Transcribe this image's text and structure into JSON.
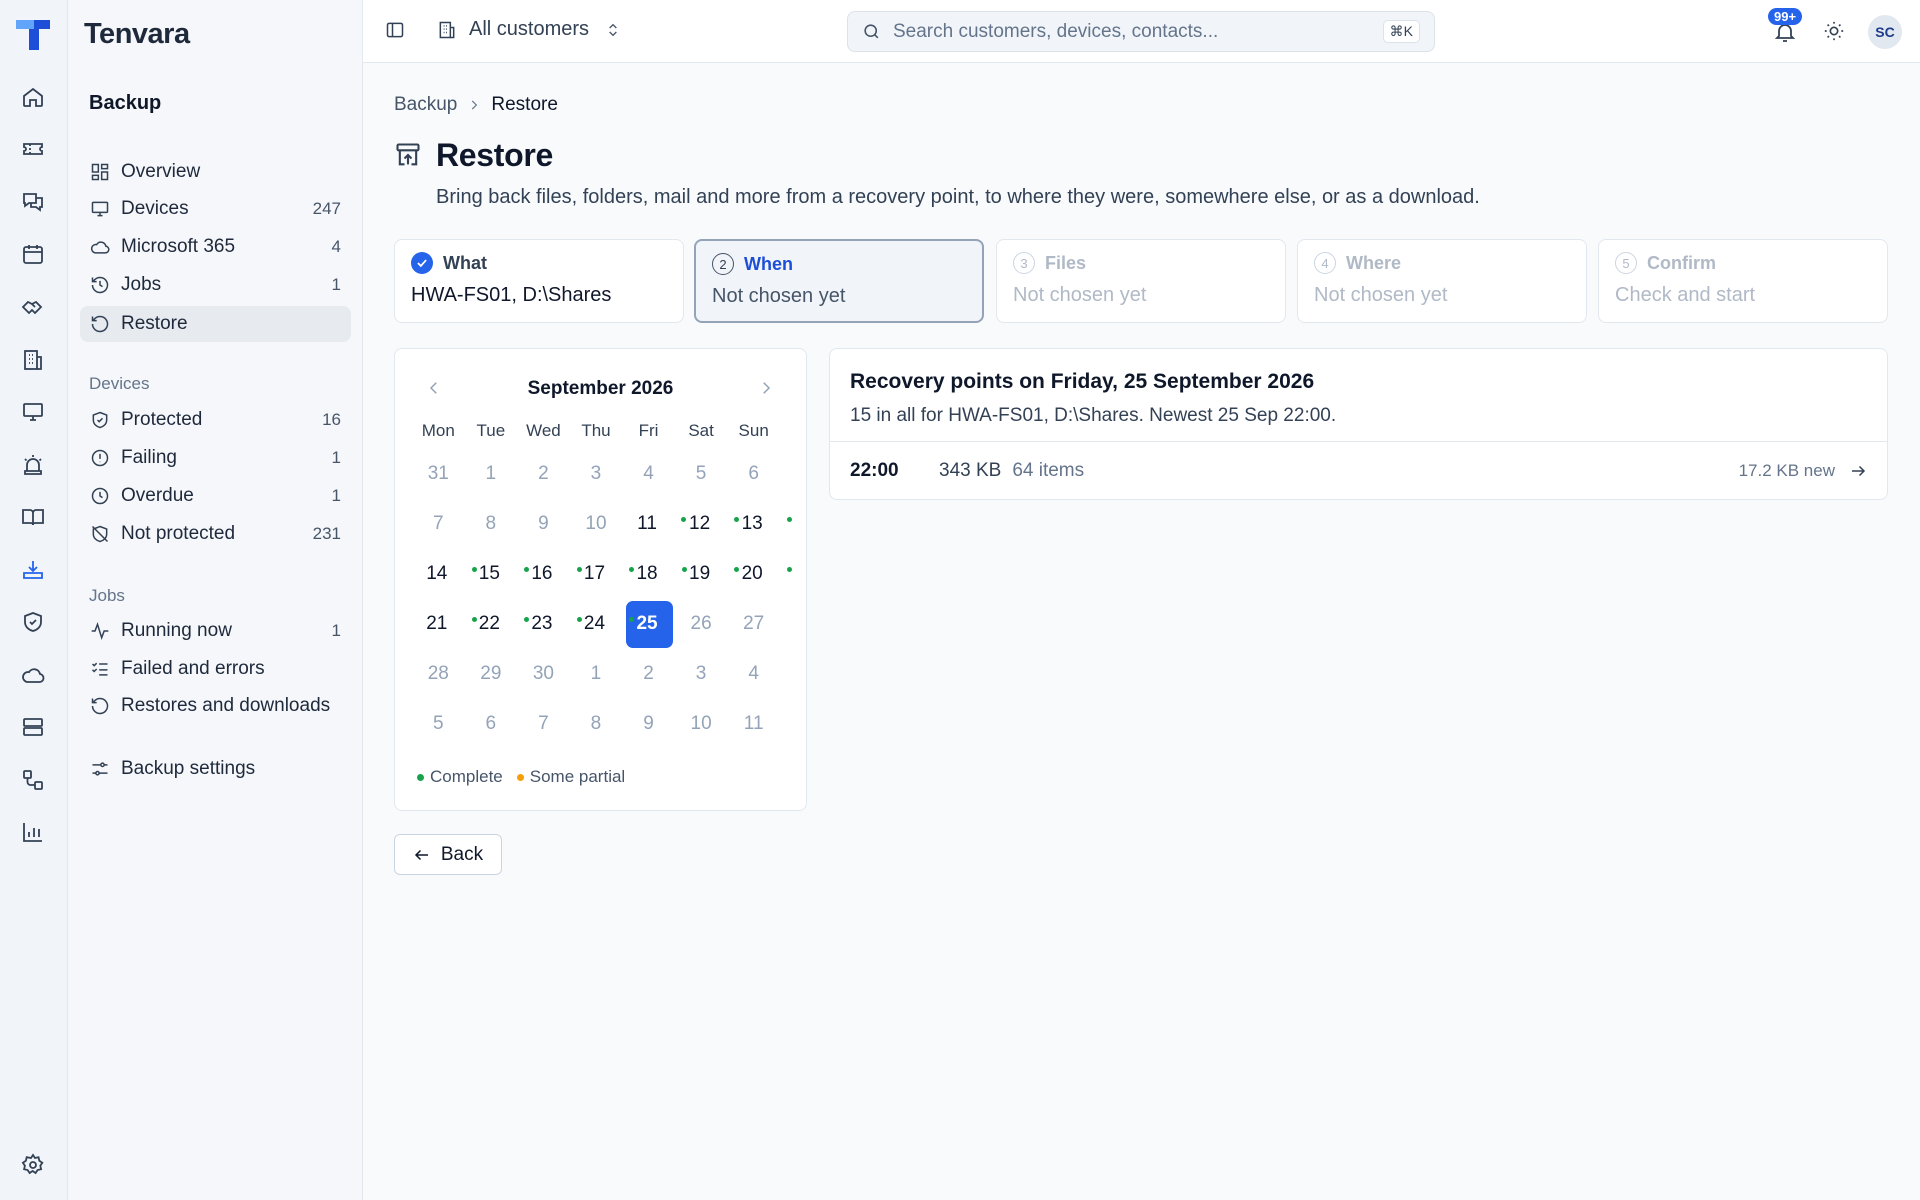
{
  "brand": {
    "name": "Tenvara"
  },
  "topbar": {
    "customer_selector": "All customers",
    "search_placeholder": "Search customers, devices, contacts...",
    "search_shortcut": "⌘K",
    "notifications_badge": "99+",
    "avatar_initials": "SC"
  },
  "sidebar": {
    "section_title": "Backup",
    "main_items": [
      {
        "label": "Overview",
        "count": "",
        "icon": "grid-icon"
      },
      {
        "label": "Devices",
        "count": "247",
        "icon": "monitor-icon"
      },
      {
        "label": "Microsoft 365",
        "count": "4",
        "icon": "cloud-icon"
      },
      {
        "label": "Jobs",
        "count": "1",
        "icon": "history-icon"
      },
      {
        "label": "Restore",
        "count": "",
        "icon": "restore-icon",
        "active": true
      }
    ],
    "devices_group": {
      "title": "Devices",
      "items": [
        {
          "label": "Protected",
          "count": "16",
          "icon": "shield-check-icon"
        },
        {
          "label": "Failing",
          "count": "1",
          "icon": "alert-circle-icon"
        },
        {
          "label": "Overdue",
          "count": "1",
          "icon": "clock-icon"
        },
        {
          "label": "Not protected",
          "count": "231",
          "icon": "shield-off-icon"
        }
      ]
    },
    "jobs_group": {
      "title": "Jobs",
      "items": [
        {
          "label": "Running now",
          "count": "1",
          "icon": "activity-icon"
        },
        {
          "label": "Failed and errors",
          "count": "",
          "icon": "list-checks-icon"
        },
        {
          "label": "Restores and downloads",
          "count": "",
          "icon": "restore-icon"
        }
      ]
    },
    "settings_item": {
      "label": "Backup settings",
      "icon": "sliders-icon"
    }
  },
  "breadcrumb": {
    "parent": "Backup",
    "current": "Restore"
  },
  "page": {
    "title": "Restore",
    "subtitle": "Bring back files, folders, mail and more from a recovery point, to where they were, somewhere else, or as a download."
  },
  "steps": [
    {
      "number": "1",
      "title": "What",
      "value": "HWA-FS01, D:\\Shares",
      "state": "done"
    },
    {
      "number": "2",
      "title": "When",
      "value": "Not chosen yet",
      "state": "current"
    },
    {
      "number": "3",
      "title": "Files",
      "value": "Not chosen yet",
      "state": "todo"
    },
    {
      "number": "4",
      "title": "Where",
      "value": "Not chosen yet",
      "state": "todo"
    },
    {
      "number": "5",
      "title": "Confirm",
      "value": "Check and start",
      "state": "todo"
    }
  ],
  "calendar": {
    "month_label": "September 2026",
    "weekdays": [
      "Mon",
      "Tue",
      "Wed",
      "Thu",
      "Fri",
      "Sat",
      "Sun"
    ],
    "weeks": [
      [
        {
          "d": "31",
          "out": true
        },
        {
          "d": "1"
        },
        {
          "d": "2"
        },
        {
          "d": "3"
        },
        {
          "d": "4"
        },
        {
          "d": "5"
        },
        {
          "d": "6"
        }
      ],
      [
        {
          "d": "7"
        },
        {
          "d": "8"
        },
        {
          "d": "9"
        },
        {
          "d": "10"
        },
        {
          "d": "11",
          "dot": "complete",
          "has": true
        },
        {
          "d": "12",
          "dot": "complete",
          "has": true
        },
        {
          "d": "13",
          "dot": "complete",
          "has": true
        }
      ],
      [
        {
          "d": "14",
          "dot": "complete",
          "has": true
        },
        {
          "d": "15",
          "dot": "complete",
          "has": true
        },
        {
          "d": "16",
          "dot": "complete",
          "has": true
        },
        {
          "d": "17",
          "dot": "complete",
          "has": true
        },
        {
          "d": "18",
          "dot": "complete",
          "has": true
        },
        {
          "d": "19",
          "dot": "complete",
          "has": true
        },
        {
          "d": "20",
          "dot": "complete",
          "has": true
        }
      ],
      [
        {
          "d": "21",
          "dot": "complete",
          "has": true
        },
        {
          "d": "22",
          "dot": "complete",
          "has": true
        },
        {
          "d": "23",
          "dot": "complete",
          "has": true
        },
        {
          "d": "24",
          "dot": "complete",
          "has": true
        },
        {
          "d": "25",
          "dot": "complete",
          "has": true,
          "selected": true
        },
        {
          "d": "26"
        },
        {
          "d": "27"
        }
      ],
      [
        {
          "d": "28"
        },
        {
          "d": "29"
        },
        {
          "d": "30"
        },
        {
          "d": "1",
          "out": true
        },
        {
          "d": "2",
          "out": true
        },
        {
          "d": "3",
          "out": true
        },
        {
          "d": "4",
          "out": true
        }
      ],
      [
        {
          "d": "5",
          "out": true
        },
        {
          "d": "6",
          "out": true
        },
        {
          "d": "7",
          "out": true
        },
        {
          "d": "8",
          "out": true
        },
        {
          "d": "9",
          "out": true
        },
        {
          "d": "10",
          "out": true
        },
        {
          "d": "11",
          "out": true
        }
      ]
    ],
    "legend": [
      {
        "label": "Complete",
        "color": "#16a34a"
      },
      {
        "label": "Some partial",
        "color": "#f59e0b"
      }
    ]
  },
  "recovery_points": {
    "title": "Recovery points on Friday, 25 September 2026",
    "summary": "15 in all for HWA-FS01, D:\\Shares. Newest 25 Sep 22:00.",
    "rows": [
      {
        "time": "22:00",
        "size": "343 KB",
        "items": "64 items",
        "new": "17.2 KB new"
      }
    ]
  },
  "actions": {
    "back_label": "Back"
  },
  "colors": {
    "accent": "#2563eb",
    "complete": "#16a34a",
    "partial": "#f59e0b"
  }
}
